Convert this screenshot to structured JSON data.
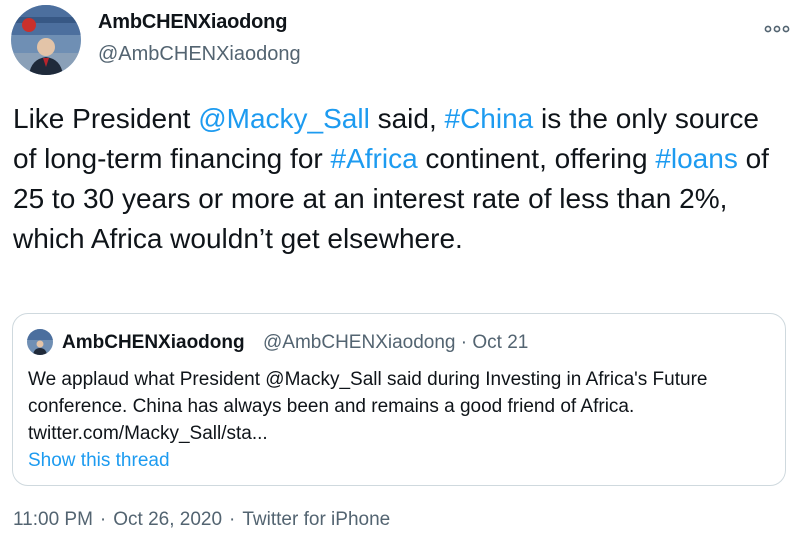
{
  "author": {
    "display_name": "AmbCHENXiaodong",
    "handle": "@AmbCHENXiaodong"
  },
  "tweet": {
    "parts": {
      "p1": "Like President ",
      "mention": "@Macky_Sall",
      "p2": " said, ",
      "tag_china": "#China",
      "p3": " is the only source of long-term financing for ",
      "tag_africa": "#Africa",
      "p4": " continent, offering ",
      "tag_loans": "#loans",
      "p5": " of 25 to 30 years or more at an interest rate of less than 2%, which Africa wouldn’t get elsewhere."
    }
  },
  "quoted_tweet": {
    "display_name": "AmbCHENXiaodong",
    "handle_date": "@AmbCHENXiaodong · Oct 21",
    "lines": [
      "We applaud what President @Macky_Sall said during  Investing in Africa's Future",
      "conference. China has always been and remains a good friend of Africa.",
      "twitter.com/Macky_Sall/sta..."
    ],
    "show_thread": "Show this thread"
  },
  "footer": {
    "time": "11:00 PM",
    "date": "Oct 26, 2020",
    "source": "Twitter for iPhone",
    "separator": "·"
  },
  "colors": {
    "link": "#1d9bf0",
    "text": "#0f1419",
    "muted": "#536471",
    "border": "#cfd9de"
  },
  "icons": {
    "more": "more-horizontal-icon"
  }
}
